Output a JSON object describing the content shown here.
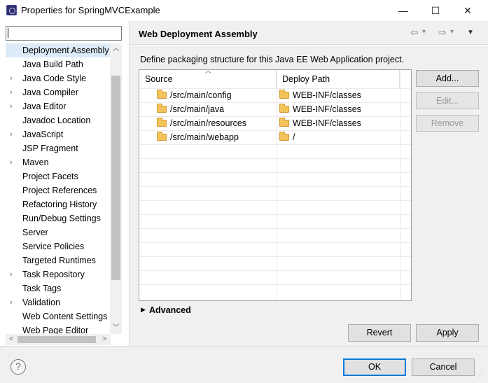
{
  "window": {
    "title": "Properties for SpringMVCExample",
    "minimize": "—",
    "maximize": "☐",
    "close": "✕"
  },
  "filter": {
    "value": "",
    "placeholder": ""
  },
  "tree": {
    "items": [
      {
        "label": "Deployment Assembly",
        "expandable": false,
        "selected": true
      },
      {
        "label": "Java Build Path",
        "expandable": false
      },
      {
        "label": "Java Code Style",
        "expandable": true
      },
      {
        "label": "Java Compiler",
        "expandable": true
      },
      {
        "label": "Java Editor",
        "expandable": true
      },
      {
        "label": "Javadoc Location",
        "expandable": false
      },
      {
        "label": "JavaScript",
        "expandable": true
      },
      {
        "label": "JSP Fragment",
        "expandable": false
      },
      {
        "label": "Maven",
        "expandable": true
      },
      {
        "label": "Project Facets",
        "expandable": false
      },
      {
        "label": "Project References",
        "expandable": false
      },
      {
        "label": "Refactoring History",
        "expandable": false
      },
      {
        "label": "Run/Debug Settings",
        "expandable": false
      },
      {
        "label": "Server",
        "expandable": false
      },
      {
        "label": "Service Policies",
        "expandable": false
      },
      {
        "label": "Targeted Runtimes",
        "expandable": false
      },
      {
        "label": "Task Repository",
        "expandable": true
      },
      {
        "label": "Task Tags",
        "expandable": false
      },
      {
        "label": "Validation",
        "expandable": true
      },
      {
        "label": "Web Content Settings",
        "expandable": false
      },
      {
        "label": "Web Page Editor",
        "expandable": false
      }
    ]
  },
  "page": {
    "title": "Web Deployment Assembly",
    "description": "Define packaging structure for this Java EE Web Application project.",
    "nav": {
      "back": "⇦",
      "forward": "⇨",
      "dropdown": "▾",
      "menu": "▼"
    }
  },
  "table": {
    "columns": [
      "Source",
      "Deploy Path"
    ],
    "rows": [
      {
        "source": "/src/main/config",
        "deploy": "WEB-INF/classes"
      },
      {
        "source": "/src/main/java",
        "deploy": "WEB-INF/classes"
      },
      {
        "source": "/src/main/resources",
        "deploy": "WEB-INF/classes"
      },
      {
        "source": "/src/main/webapp",
        "deploy": "/"
      }
    ],
    "empty_rows": 11
  },
  "side_buttons": {
    "add": "Add...",
    "edit": "Edit...",
    "remove": "Remove"
  },
  "advanced": {
    "label": "Advanced"
  },
  "buttons": {
    "revert": "Revert",
    "apply": "Apply",
    "ok": "OK",
    "cancel": "Cancel"
  },
  "help": {
    "glyph": "?"
  },
  "colors": {
    "selection": "#ddeaf7",
    "focus": "#0078d7",
    "panel": "#f0f0f0"
  }
}
